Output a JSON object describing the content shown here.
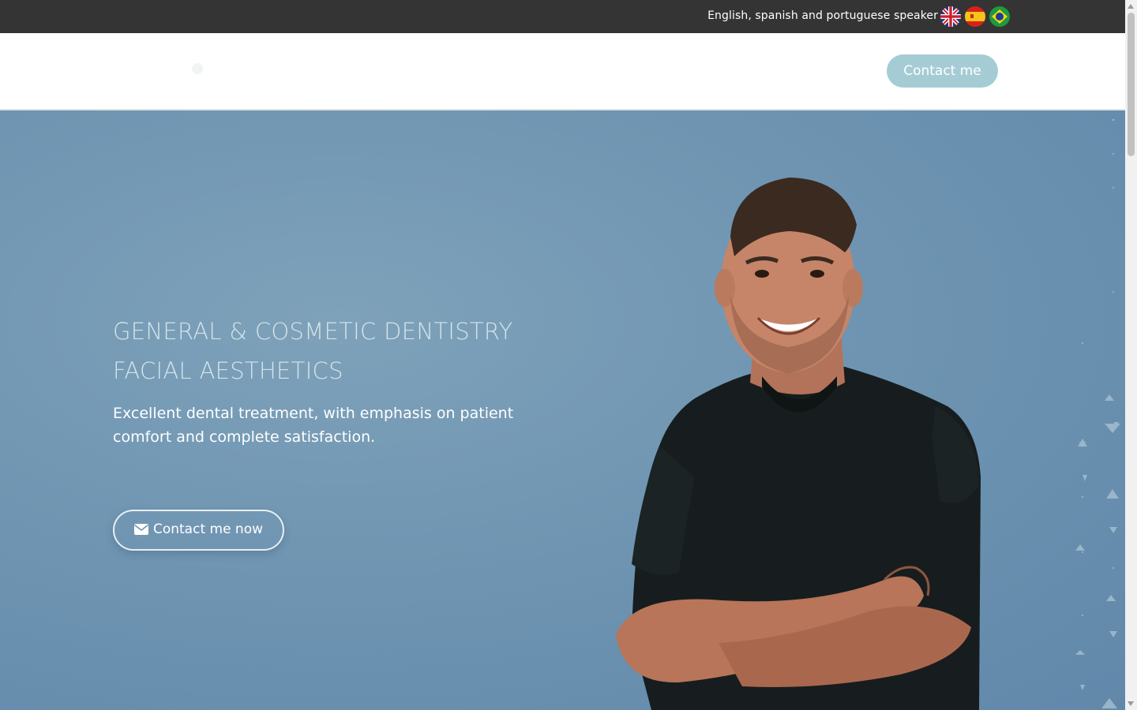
{
  "topbar": {
    "language_text": "English, spanish and portuguese speaker",
    "flags": [
      {
        "name": "uk-flag-icon",
        "label": "English"
      },
      {
        "name": "spain-flag-icon",
        "label": "Spanish"
      },
      {
        "name": "brazil-flag-icon",
        "label": "Portuguese"
      }
    ]
  },
  "header": {
    "contact_label": "Contact me"
  },
  "hero": {
    "title_line1": "GENERAL & COSMETIC DENTISTRY",
    "title_line2": "FACIAL AESTHETICS",
    "subtitle": "Excellent dental treatment, with emphasis on patient comfort and complete satisfaction.",
    "cta_label": "Contact me now",
    "cta_icon": "envelope-icon"
  },
  "colors": {
    "topbar_bg": "#343434",
    "accent": "#a5ccd5",
    "hero_bg": "#6f95b2",
    "hero_title": "#d3e4ea",
    "shirt": "#171d1e"
  }
}
